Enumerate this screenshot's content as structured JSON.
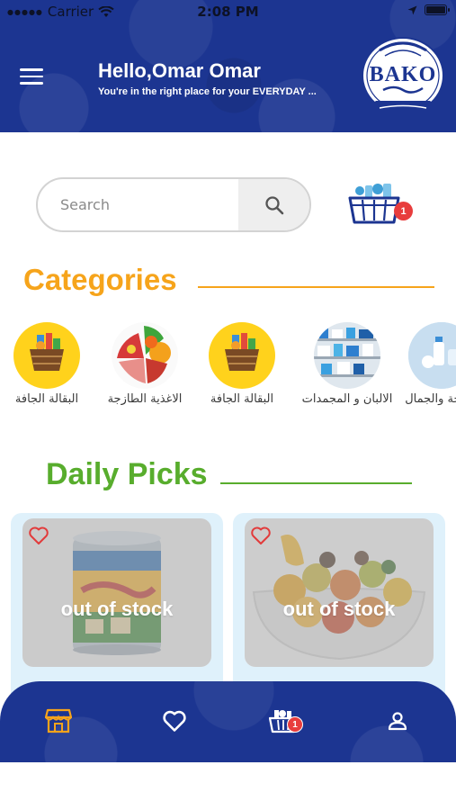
{
  "status_bar": {
    "carrier": "Carrier",
    "time": "2:08 PM"
  },
  "header": {
    "greeting": "Hello,Omar Omar",
    "subtitle": "You're in the right place for your EVERYDAY ...",
    "logo_text": "BAKO"
  },
  "search": {
    "placeholder": "Search",
    "value": ""
  },
  "cart": {
    "badge_count": "1"
  },
  "categories": {
    "title": "Categories",
    "items": [
      {
        "label": "البقالة الجافة",
        "icon": "basket-icon"
      },
      {
        "label": "الاغذية الطازجة",
        "icon": "fresh-food-icon"
      },
      {
        "label": "البقالة الجافة",
        "icon": "basket-icon"
      },
      {
        "label": "الالبان و المجمدات",
        "icon": "dairy-shelf-icon"
      },
      {
        "label": "الصحة والجمال",
        "icon": "beauty-icon"
      }
    ]
  },
  "daily_picks": {
    "title": "Daily Picks",
    "products": [
      {
        "status": "out of stock",
        "image": "canned-food"
      },
      {
        "status": "out of stock",
        "image": "mixed-pickles"
      }
    ]
  },
  "bottom_nav": {
    "items": [
      "store-icon",
      "heart-icon",
      "cart-icon",
      "profile-icon"
    ],
    "cart_badge": "1"
  },
  "colors": {
    "brand_blue": "#1c3591",
    "categories_accent": "#f6a41b",
    "daily_picks_accent": "#58ad2d",
    "badge_red": "#e83d3d",
    "card_bg": "#dff1fb"
  }
}
